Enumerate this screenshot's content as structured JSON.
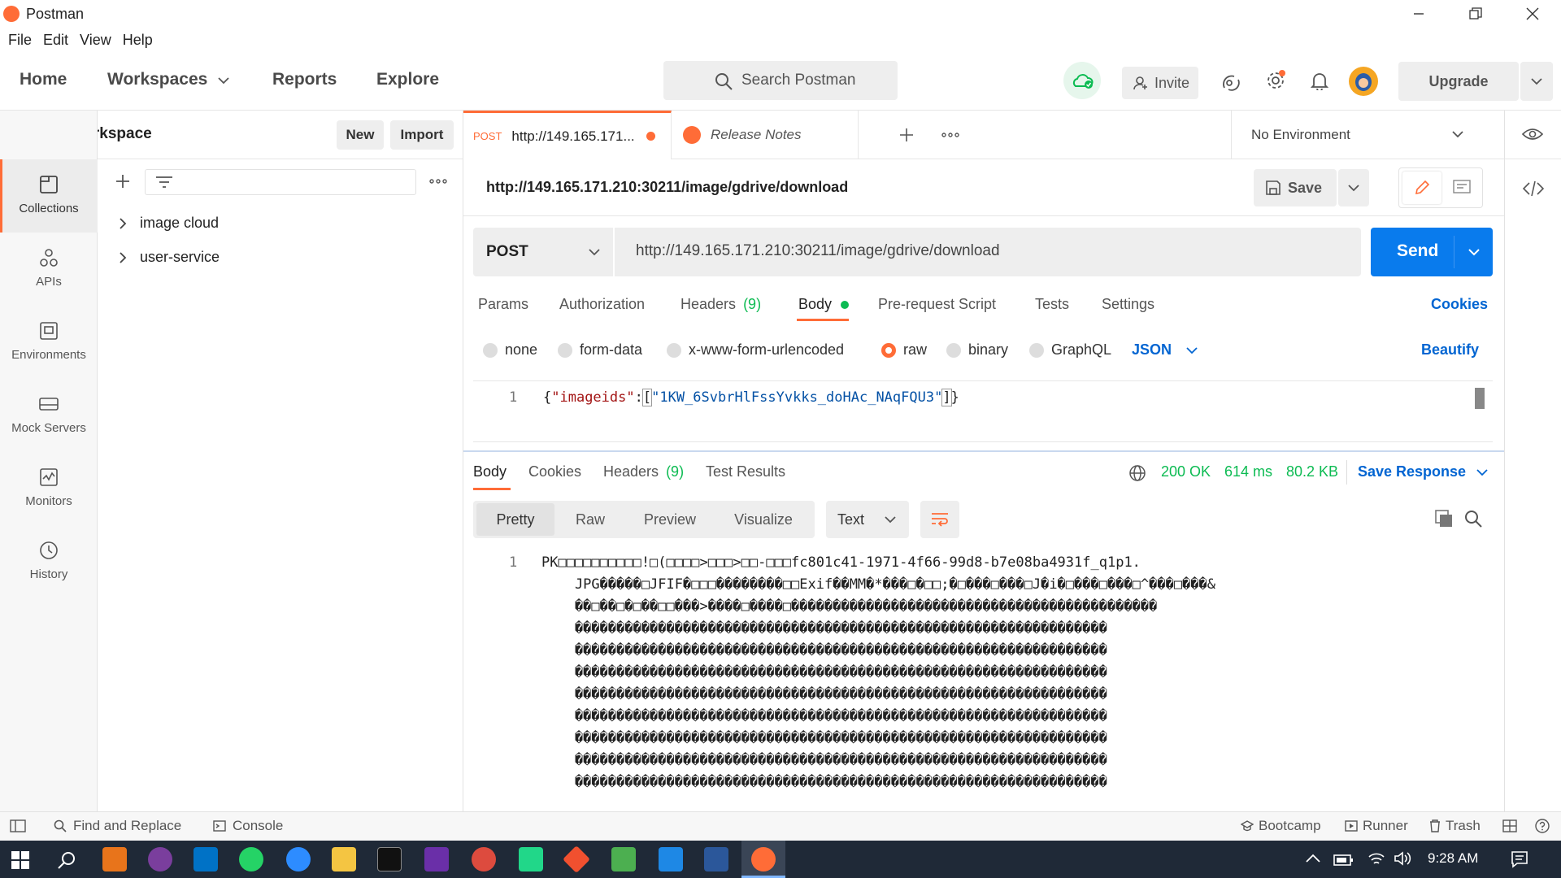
{
  "window": {
    "title": "Postman"
  },
  "menu": [
    "File",
    "Edit",
    "View",
    "Help"
  ],
  "header": {
    "nav": [
      "Home",
      "Workspaces",
      "Reports",
      "Explore"
    ],
    "search_placeholder": "Search Postman",
    "invite": "Invite",
    "upgrade": "Upgrade"
  },
  "workspace": {
    "name": "My Workspace",
    "new": "New",
    "import": "Import"
  },
  "rail": [
    "Collections",
    "APIs",
    "Environments",
    "Mock Servers",
    "Monitors",
    "History"
  ],
  "collections": [
    "image cloud",
    "user-service"
  ],
  "tabs": {
    "active_method": "POST",
    "active_title": "http://149.165.171...",
    "second_title": "Release Notes",
    "environment": "No Environment"
  },
  "request": {
    "name": "http://149.165.171.210:30211/image/gdrive/download",
    "save": "Save",
    "method": "POST",
    "url": "http://149.165.171.210:30211/image/gdrive/download",
    "send": "Send"
  },
  "req_tabs": {
    "params": "Params",
    "authorization": "Authorization",
    "headers": "Headers",
    "headers_count": "(9)",
    "body": "Body",
    "prerequest": "Pre-request Script",
    "tests": "Tests",
    "settings": "Settings",
    "cookies": "Cookies"
  },
  "body_types": {
    "none": "none",
    "form_data": "form-data",
    "urlencoded": "x-www-form-urlencoded",
    "raw": "raw",
    "binary": "binary",
    "graphql": "GraphQL",
    "json": "JSON",
    "beautify": "Beautify",
    "selected": "raw"
  },
  "editor": {
    "line_no": "1",
    "open": "{",
    "key": "\"imageids\"",
    "colon": ":",
    "lbr": "[",
    "value": "\"1KW_6SvbrHlFssYvkks_doHAc_NAqFQU3\"",
    "rbr": "]",
    "close": "}"
  },
  "response": {
    "tabs": {
      "body": "Body",
      "cookies": "Cookies",
      "headers": "Headers",
      "headers_count": "(9)",
      "tests": "Test Results"
    },
    "status": "200 OK",
    "time": "614 ms",
    "size": "80.2 KB",
    "save_response": "Save Response",
    "views": {
      "pretty": "Pretty",
      "raw": "Raw",
      "preview": "Preview",
      "visualize": "Visualize"
    },
    "format": "Text",
    "line_no": "1",
    "lines": [
      "PK□□□□□□□□□□!□(□□□□>□□□>□□-□□□fc801c41-1971-4f66-99d8-b7e08ba4931f_q1p1.",
      "    JPG�����□JFIF�□□□��������□□Exif��MM�*���□�□□;�□���□���□J�i�□���□���□^���□���&",
      "    ��□��□�□��□□���>����□����□��������������������������������������������",
      "    ����������������������������������������������������������������",
      "    ����������������������������������������������������������������",
      "    ����������������������������������������������������������������",
      "    ����������������������������������������������������������������",
      "    ����������������������������������������������������������������",
      "    ����������������������������������������������������������������",
      "    ����������������������������������������������������������������",
      "    ����������������������������������������������������������������"
    ]
  },
  "statusbar": {
    "find": "Find and Replace",
    "console": "Console",
    "bootcamp": "Bootcamp",
    "runner": "Runner",
    "trash": "Trash"
  },
  "taskbar": {
    "time": "9:28 AM"
  },
  "colors": {
    "accent": "#ff6c37",
    "send": "#097bed",
    "link": "#0265d2",
    "status_ok": "#0cbb52"
  }
}
